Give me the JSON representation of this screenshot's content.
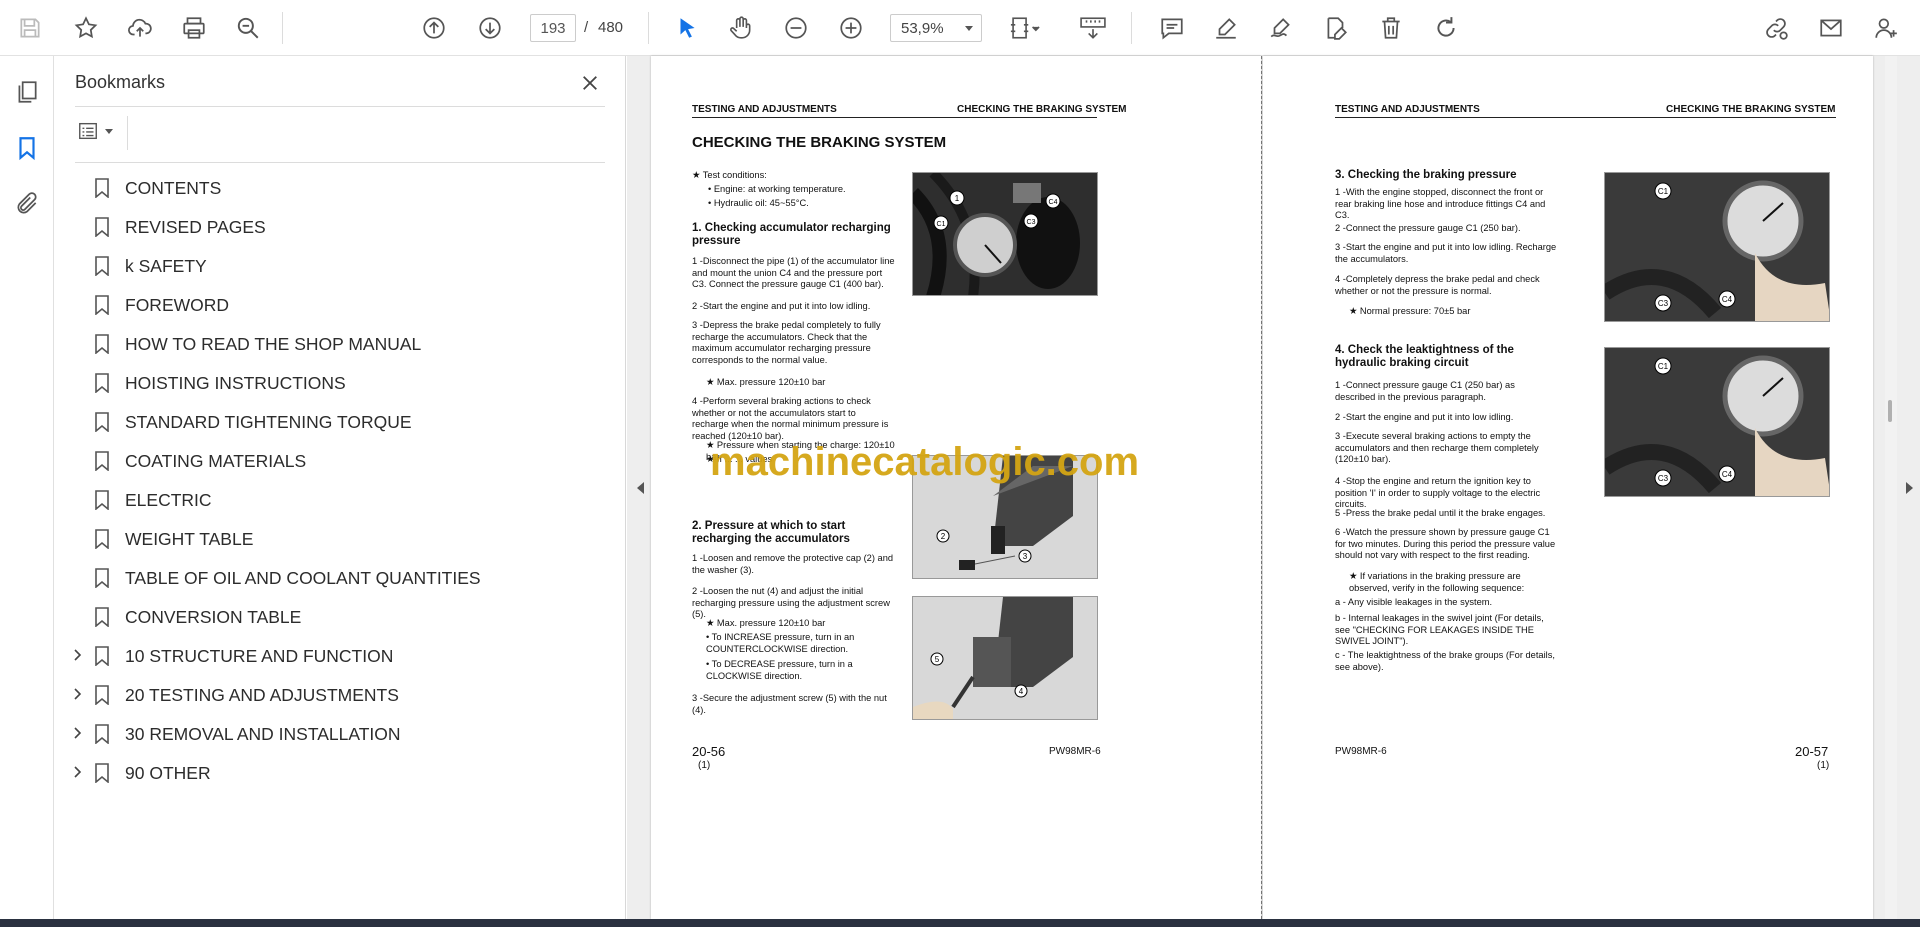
{
  "toolbar": {
    "current_page": "193",
    "page_separator": "/",
    "total_pages": "480",
    "zoom": "53,9%"
  },
  "bookmarks": {
    "title": "Bookmarks",
    "items": [
      {
        "label": "CONTENTS",
        "expandable": false
      },
      {
        "label": "REVISED PAGES",
        "expandable": false
      },
      {
        "label": "k SAFETY",
        "expandable": false
      },
      {
        "label": "FOREWORD",
        "expandable": false
      },
      {
        "label": "HOW TO READ THE SHOP MANUAL",
        "expandable": false
      },
      {
        "label": "HOISTING INSTRUCTIONS",
        "expandable": false
      },
      {
        "label": "STANDARD TIGHTENING TORQUE",
        "expandable": false
      },
      {
        "label": "COATING MATERIALS",
        "expandable": false
      },
      {
        "label": "ELECTRIC",
        "expandable": false
      },
      {
        "label": "WEIGHT TABLE",
        "expandable": false
      },
      {
        "label": "TABLE OF OIL AND COOLANT QUANTITIES",
        "expandable": false
      },
      {
        "label": "CONVERSION TABLE",
        "expandable": false
      },
      {
        "label": "10 STRUCTURE AND FUNCTION",
        "expandable": true
      },
      {
        "label": "20 TESTING AND ADJUSTMENTS",
        "expandable": true
      },
      {
        "label": "30 REMOVAL AND INSTALLATION",
        "expandable": true
      },
      {
        "label": "90 OTHER",
        "expandable": true
      }
    ]
  },
  "left_page": {
    "header_left": "TESTING AND ADJUSTMENTS",
    "header_right": "CHECKING THE BRAKING SYSTEM",
    "title": "CHECKING THE BRAKING SYSTEM",
    "test_conditions": "★  Test conditions:",
    "cond1": "•    Engine: at working temperature.",
    "cond2": "•    Hydraulic oil: 45~55°C.",
    "s1_title": "1.  Checking   accumulator   recharging pressure",
    "s1_p1": "1 -Disconnect the pipe (1) of the accumulator line and mount the union C4 and the pressure port C3. Connect the pressure gauge C1 (400 bar).",
    "s1_p2": "2 -Start the engine and put it into low idling.",
    "s1_p3": "3 -Depress the brake pedal completely to fully recharge the accumulators. Check that the maximum accumulator recharging pressure corresponds to the normal value.",
    "s1_star1": "★    Max. pressure 120±10 bar",
    "s1_p4": "4 -Perform several braking actions to check whether or not the accumulators start to recharge when the normal minimum pressure is reached  (120±10 bar).",
    "s1_star2": "★    Pressure when starting the charge: 120±10 bar",
    "s1_star3": "★    If ...  ... values",
    "s2_title": "2. Pressure at which to start recharging the accumulators",
    "s2_p1": "1 -Loosen and remove the protective cap (2) and the washer (3).",
    "s2_p2": "2 -Loosen the nut (4) and adjust the initial recharging pressure using the adjustment screw (5).",
    "s2_star": "★    Max. pressure 120±10 bar",
    "s2_b1": "•    To   INCREASE   pressure,   turn   in   an COUNTERCLOCKWISE direction.",
    "s2_b2": "•    To DECREASE pressure, turn in a CLOCKWISE direction.",
    "s2_p3": "3 -Secure the adjustment screw (5) with the nut (4).",
    "footer_page": "20-56",
    "footer_rev": "(1)",
    "footer_model": "PW98MR-6",
    "photo1_labels": [
      "1",
      "C1",
      "C3",
      "C4"
    ],
    "photo2_labels": [
      "2",
      "3"
    ],
    "photo3_labels": [
      "5",
      "4"
    ]
  },
  "right_page": {
    "header_left": "TESTING AND ADJUSTMENTS",
    "header_right": "CHECKING THE BRAKING SYSTEM",
    "s3_title": "3.   Checking the braking pressure",
    "s3_p1": "1 -With the engine stopped, disconnect the front or rear braking line hose and introduce fittings C4 and C3.",
    "s3_p2": "2 -Connect the pressure gauge C1 (250 bar).",
    "s3_p3": "3 -Start the engine and put it into low idling. Recharge the accumulators.",
    "s3_p4": "4 -Completely depress the brake pedal and check whether or not the pressure is normal.",
    "s3_star": "★    Normal pressure: 70±5 bar",
    "s4_title": "4.   Check the leaktightness of the hydraulic braking circuit",
    "s4_p1": "1 -Connect pressure gauge C1 (250 bar) as described in the previous paragraph.",
    "s4_p2": "2 -Start the engine and put it into low idling.",
    "s4_p3": "3 -Execute several braking actions to empty the accumulators and then recharge them completely (120±10 bar).",
    "s4_p4": "4 -Stop the engine and return the ignition key to position 'I' in order to supply voltage to the electric circuits.",
    "s4_p5": "5 -Press the brake pedal until it the brake engages.",
    "s4_p6": "6 -Watch the pressure shown by pressure gauge C1 for two minutes. During this period the pressure value should not vary with respect to the first reading.",
    "s4_star": "★    If variations in the braking pressure are observed, verify in the following sequence:",
    "s4_a": "a -   Any visible leakages in the system.",
    "s4_b": "b -   Internal leakages in the swivel joint (For details, see \"CHECKING FOR LEAKAGES INSIDE THE SWIVEL JOINT\").",
    "s4_c": "c -   The leaktightness of the brake groups (For details, see above).",
    "footer_page": "20-57",
    "footer_rev": "(1)",
    "footer_model": "PW98MR-6",
    "photo_labels": [
      "C1",
      "C3",
      "C4"
    ]
  },
  "watermark": "machinecatalogic.com",
  "colors": {
    "accent": "#1473e6",
    "watermark": "#d4a514",
    "bottom_bar": "#2a3140"
  }
}
